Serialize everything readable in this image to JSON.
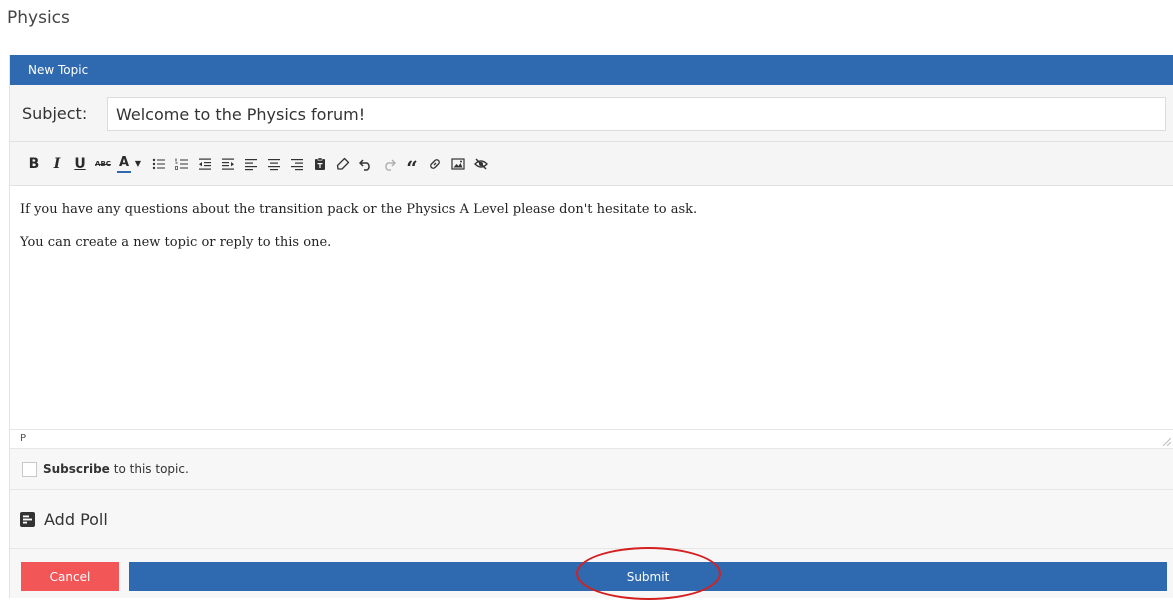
{
  "page": {
    "title": "Physics"
  },
  "panel": {
    "header": "New Topic"
  },
  "subject": {
    "label": "Subject:",
    "value": "Welcome to the Physics forum!"
  },
  "toolbar": {
    "buttons": [
      "bold-icon",
      "italic-icon",
      "underline-icon",
      "strikethrough-icon",
      "text-color-icon",
      "bullet-list-icon",
      "numbered-list-icon",
      "outdent-icon",
      "indent-icon",
      "align-left-icon",
      "align-center-icon",
      "align-right-icon",
      "paste-text-icon",
      "clear-formatting-icon",
      "undo-icon",
      "redo-icon",
      "blockquote-icon",
      "link-icon",
      "image-icon",
      "spoiler-icon"
    ],
    "bold": "B",
    "italic": "I",
    "underline": "U",
    "strike": "ABC",
    "text_color": "A",
    "caret": "▼",
    "quote": "“"
  },
  "editor": {
    "paragraphs": [
      "If you have any questions about the transition pack or the Physics A Level please don't hesitate to ask.",
      "You can create a new topic or reply to this one."
    ],
    "path": "P"
  },
  "subscribe": {
    "strong": "Subscribe",
    "rest": "to this topic.",
    "checked": false
  },
  "poll": {
    "label": "Add Poll"
  },
  "actions": {
    "cancel": "Cancel",
    "submit": "Submit"
  },
  "colors": {
    "primary": "#2f6ab0",
    "danger": "#f25656",
    "highlight": "#d42020"
  }
}
